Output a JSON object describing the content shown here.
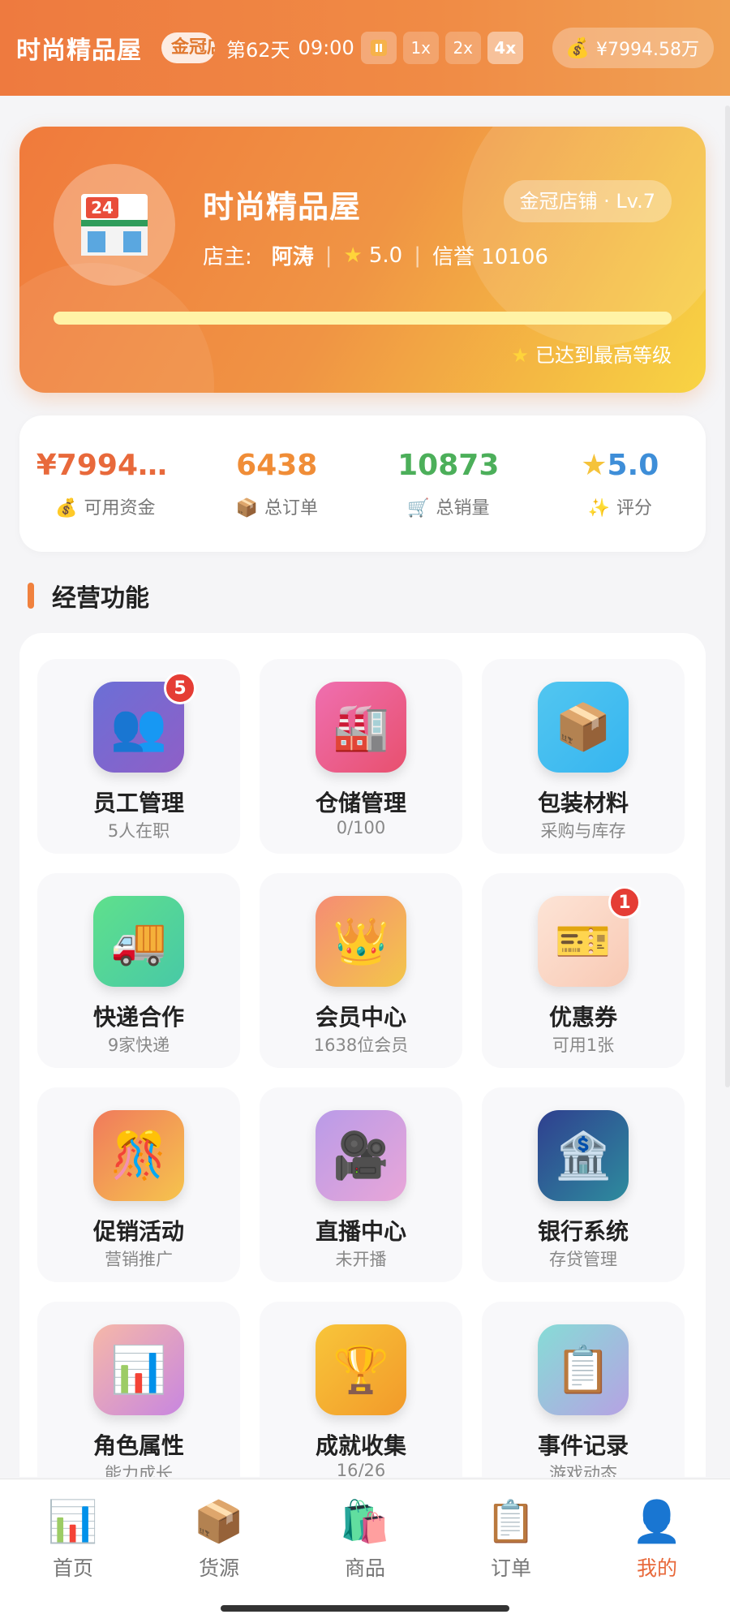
{
  "header": {
    "app_title": "时尚精品屋",
    "level_chip": "金冠店铺",
    "day": "第62天",
    "time": "09:00",
    "speeds": [
      "1x",
      "2x",
      "4x"
    ],
    "active_speed": "4x",
    "money_icon": "money-bag-icon",
    "money": "¥7994.58万"
  },
  "shop": {
    "name": "时尚精品屋",
    "level_badge": "金冠店铺 · Lv.7",
    "owner_label": "店主:",
    "owner_name": "阿涛",
    "rating": "5.0",
    "reputation": "信誉 10106",
    "exp_progress": 1.0,
    "max_note": "已达到最高等级",
    "avatar_icon": "convenience-store-icon",
    "store_sign": "24"
  },
  "stats": [
    {
      "value": "¥7994....",
      "label": "可用资金",
      "icon": "money-bag-icon"
    },
    {
      "value": "6438",
      "label": "总订单",
      "icon": "package-icon"
    },
    {
      "value": "10873",
      "label": "总销量",
      "icon": "cart-icon"
    },
    {
      "value": "5.0",
      "label": "评分",
      "icon": "sparkles-icon"
    }
  ],
  "section_title": "经营功能",
  "features": [
    {
      "title": "员工管理",
      "sub": "5人在职",
      "badge": "5",
      "icon": "people-icon",
      "glyph": "👥"
    },
    {
      "title": "仓储管理",
      "sub": "0/100",
      "badge": "",
      "icon": "factory-icon",
      "glyph": "🏭"
    },
    {
      "title": "包装材料",
      "sub": "采购与库存",
      "badge": "",
      "icon": "package-icon",
      "glyph": "📦"
    },
    {
      "title": "快递合作",
      "sub": "9家快递",
      "badge": "",
      "icon": "delivery-truck-icon",
      "glyph": "🚚"
    },
    {
      "title": "会员中心",
      "sub": "1638位会员",
      "badge": "",
      "icon": "crown-icon",
      "glyph": "👑"
    },
    {
      "title": "优惠券",
      "sub": "可用1张",
      "badge": "1",
      "icon": "ticket-icon",
      "glyph": "🎫"
    },
    {
      "title": "促销活动",
      "sub": "营销推广",
      "badge": "",
      "icon": "confetti-icon",
      "glyph": "🎊"
    },
    {
      "title": "直播中心",
      "sub": "未开播",
      "badge": "",
      "icon": "movie-camera-icon",
      "glyph": "🎥"
    },
    {
      "title": "银行系统",
      "sub": "存贷管理",
      "badge": "",
      "icon": "bank-icon",
      "glyph": "🏦"
    },
    {
      "title": "角色属性",
      "sub": "能力成长",
      "badge": "",
      "icon": "bar-chart-icon",
      "glyph": "📊"
    },
    {
      "title": "成就收集",
      "sub": "16/26",
      "badge": "",
      "icon": "trophy-icon",
      "glyph": "🏆"
    },
    {
      "title": "事件记录",
      "sub": "游戏动态",
      "badge": "",
      "icon": "clipboard-icon",
      "glyph": "📋"
    }
  ],
  "nav": [
    {
      "label": "首页",
      "icon": "bar-chart-icon",
      "glyph": "📊"
    },
    {
      "label": "货源",
      "icon": "package-icon",
      "glyph": "📦"
    },
    {
      "label": "商品",
      "icon": "shopping-bags-icon",
      "glyph": "🛍️"
    },
    {
      "label": "订单",
      "icon": "clipboard-icon",
      "glyph": "📋"
    },
    {
      "label": "我的",
      "icon": "user-icon",
      "glyph": "👤"
    }
  ],
  "active_nav": "我的",
  "colors": {
    "accent": "#e8693b",
    "header_gradient_start": "#ee7a3f",
    "header_gradient_end": "#f0a052",
    "badge_red": "#e53d35"
  }
}
